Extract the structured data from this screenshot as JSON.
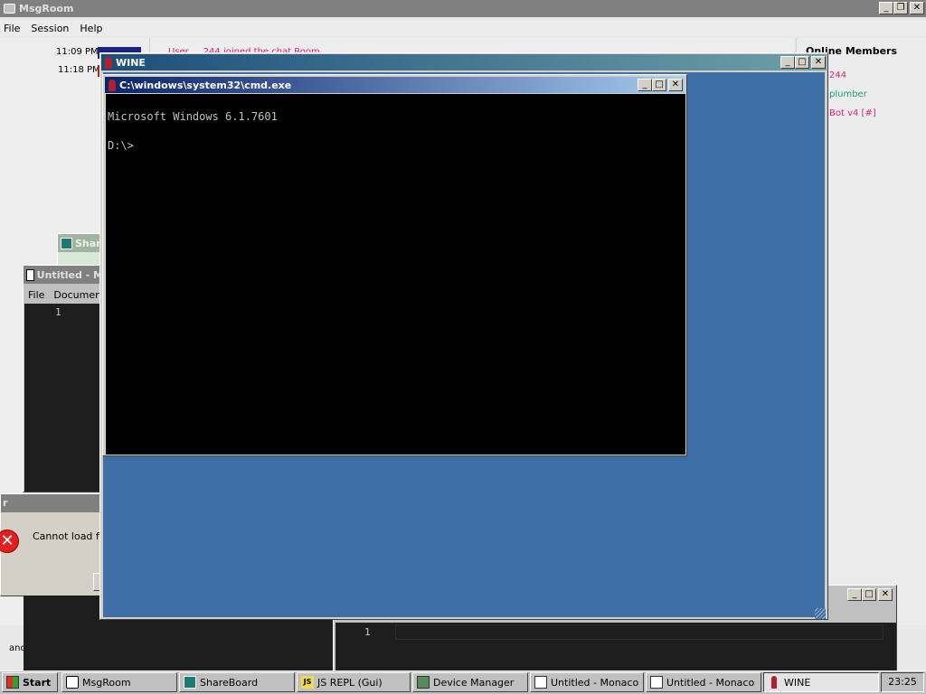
{
  "msgroom": {
    "title": "MsgRoom",
    "menu": [
      "File",
      "Session",
      "Help"
    ],
    "messages": [
      {
        "time": "11:09 PM"
      },
      {
        "time": "11:18 PM"
      }
    ],
    "partial_event": "User ... 244 joined the chat Room",
    "online_header": "Online Members",
    "members": [
      {
        "name": "244",
        "color": "#e0207a"
      },
      {
        "name": "plumber",
        "color": "#20a070"
      },
      {
        "name": "Bot v4 [#]",
        "color": "#e0207a"
      }
    ]
  },
  "shareboard_partial": {
    "title": "Shar"
  },
  "untitled_editor": {
    "title": "Untitled - M",
    "menu": [
      "File",
      "Document"
    ],
    "line_number": "1"
  },
  "error_dialog": {
    "title": "r",
    "message": "Cannot load file"
  },
  "bottom_editor": {
    "line_number": "1",
    "left_text": "and"
  },
  "wine": {
    "title": "WINE"
  },
  "cmd": {
    "title": "C:\\windows\\system32\\cmd.exe",
    "lines": [
      "Microsoft Windows 6.1.7601",
      "",
      "D:\\>"
    ]
  },
  "taskbar": {
    "start_label": "Start",
    "items": [
      {
        "label": "MsgRoom",
        "icon": "chat-icon"
      },
      {
        "label": "ShareBoard",
        "icon": "shareboard-icon"
      },
      {
        "label": "JS REPL (Gui)",
        "icon": "js-icon"
      },
      {
        "label": "Device Manager",
        "icon": "device-manager-icon"
      },
      {
        "label": "Untitled - Monaco",
        "icon": "notepad-icon"
      },
      {
        "label": "Untitled - Monaco",
        "icon": "notepad-icon"
      },
      {
        "label": "WINE",
        "icon": "wine-icon"
      }
    ],
    "clock": "23:25"
  },
  "colors": {
    "desktop_blue": "#3d6ea5",
    "title_active_start": "#0a246a",
    "title_active_end": "#a6caf0",
    "title_inactive": "#808080",
    "wine_title_start": "#1b4f7a",
    "wine_title_end": "#6ea0a8"
  }
}
